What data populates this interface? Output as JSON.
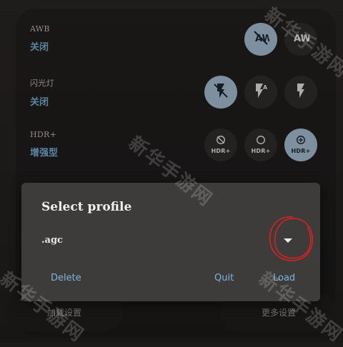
{
  "settings": [
    {
      "label": "AWB",
      "value": "关闭"
    },
    {
      "label": "闪光灯",
      "value": "关闭"
    },
    {
      "label": "HDR+",
      "value": "增强型"
    }
  ],
  "hdr_buttons": [
    {
      "text": "HDR+",
      "icon": "hdr-off-icon"
    },
    {
      "text": "HDR+",
      "icon": "hdr-on-icon"
    },
    {
      "text": "HDR+",
      "icon": "hdr-enhanced-icon"
    }
  ],
  "awb_buttons": [
    {
      "text": "AW",
      "icon": "awb-off-icon"
    },
    {
      "text": "AW",
      "icon": "awb-auto-icon"
    }
  ],
  "flash_buttons": [
    {
      "icon": "flash-off-icon"
    },
    {
      "icon": "flash-auto-icon",
      "badge": "A"
    },
    {
      "icon": "flash-on-icon"
    }
  ],
  "dialog": {
    "title": "Select profile",
    "profile_value": ".agc",
    "delete_label": "Delete",
    "quit_label": "Quit",
    "load_label": "Load"
  },
  "bottom": {
    "left_label": "加载设置",
    "right_label": "更多设置"
  },
  "watermark": "新华手游网",
  "colors": {
    "accent": "#7fb3de",
    "active_circle": "#a9c0d4",
    "dialog_bg": "#3d3c3b",
    "scribble": "#e02020"
  }
}
